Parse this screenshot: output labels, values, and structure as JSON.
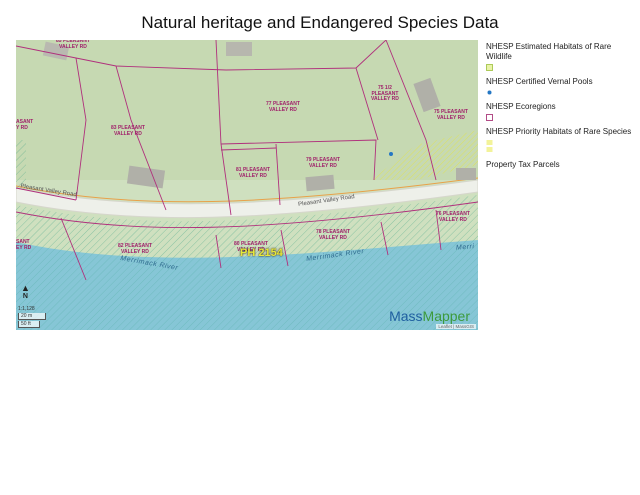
{
  "title": "Natural heritage and Endangered Species Data",
  "legend": {
    "estimated_habitats": "NHESP Estimated Habitats of Rare Wildlife",
    "vernal_pools": "NHESP Certified Vernal Pools",
    "ecoregions": "NHESP Ecoregions",
    "priority_habitats": "NHESP Priority Habitats of Rare Species",
    "tax_parcels": "Property Tax Parcels"
  },
  "map": {
    "parcels": {
      "p85": "85 PLEASANT\nVALLEY RD",
      "p83": "83 PLEASANT\nVALLEY RD",
      "p77": "77 PLEASANT\nVALLEY RD",
      "p75": "75 1/2\nPLEASANT\nVALLEY RD",
      "p75b": "75 PLEASANT\nVALLEY RD",
      "p81": "81 PLEASANT\nVALLEY RD",
      "p79": "79 PLEASANT\nVALLEY RD",
      "p82": "82 PLEASANT\nVALLEY RD",
      "p80": "80 PLEASANT\nVALLEY RD",
      "p78": "78 PLEASANT\nVALLEY RD",
      "p76": "76 PLEASANT\nVALLEY RD",
      "pleft1": "ASANT\nY RD",
      "pleft2": "SANT\nEY RD"
    },
    "road_label_1": "Pleasant Valley Road",
    "road_label_2": "Pleasant Valley Road",
    "river_label_1": "Merrimack River",
    "river_label_2": "Merrimack River",
    "river_label_3": "Merri",
    "priority_label": "PH 2154",
    "north_label": "N",
    "scale_ratio": "1:1,128",
    "scale_m": "20 m",
    "scale_ft": "50 ft",
    "brand_part1": "Mass",
    "brand_part2": "Mapper",
    "attribution": "Leaflet | MassGIS"
  },
  "colors": {
    "land": "#cfe0bf",
    "water": "#86c6d6",
    "parcel_line": "#b0307c",
    "priority": "#e4e44a",
    "estimated": "#2a9a7a"
  }
}
